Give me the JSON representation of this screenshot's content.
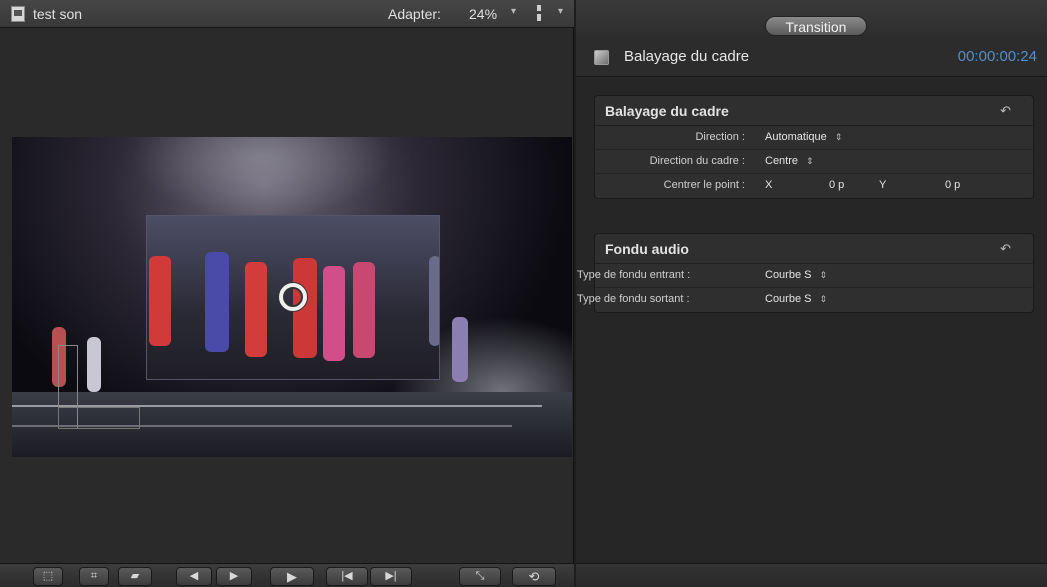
{
  "viewer": {
    "clip_title": "test son",
    "zoom_label": "Adapter:",
    "zoom_value": "24%",
    "clip_icon": "film-clip-icon",
    "toolbar_icons": [
      "transform-icon",
      "crop-icon",
      "distort-icon",
      "previous-frame-icon",
      "next-frame-icon",
      "play-icon",
      "go-to-start-icon",
      "go-to-end-icon",
      "fullscreen-icon",
      "loop-icon"
    ]
  },
  "inspector": {
    "tab_label": "Transition",
    "transition_name": "Balayage du cadre",
    "duration": "00:00:00:24",
    "groups": [
      {
        "title": "Balayage du cadre",
        "rows": [
          {
            "label": "Direction :",
            "value": "Automatique"
          },
          {
            "label": "Direction du cadre :",
            "value": "Centre"
          }
        ],
        "point": {
          "label": "Centrer le point :",
          "x_label": "X",
          "x_value": "0 p",
          "y_label": "Y",
          "y_value": "0 p"
        }
      },
      {
        "title": "Fondu audio",
        "rows": [
          {
            "label": "Type de fondu entrant :",
            "value": "Courbe S"
          },
          {
            "label": "Type de fondu sortant :",
            "value": "Courbe S"
          }
        ]
      }
    ]
  },
  "colors": {
    "timecode": "#4f8fcf",
    "panel_bg": "#262626"
  }
}
